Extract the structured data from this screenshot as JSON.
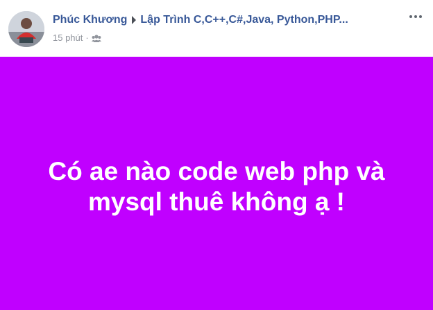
{
  "author": {
    "name": "Phúc Khương",
    "avatar_icon": "profile-photo"
  },
  "group": {
    "name": "Lập Trình C,C++,C#,Java, Python,PHP...",
    "separator_icon": "triangle-right-icon"
  },
  "meta": {
    "time": "15 phút",
    "dot": "·",
    "audience_icon": "group-audience-icon"
  },
  "menu": {
    "icon": "more-options-icon"
  },
  "post": {
    "background_color": "#c000ff",
    "text_color": "#ffffff",
    "line1": "Có ae nào code web php và",
    "line2": "mysql thuê không ạ !"
  }
}
